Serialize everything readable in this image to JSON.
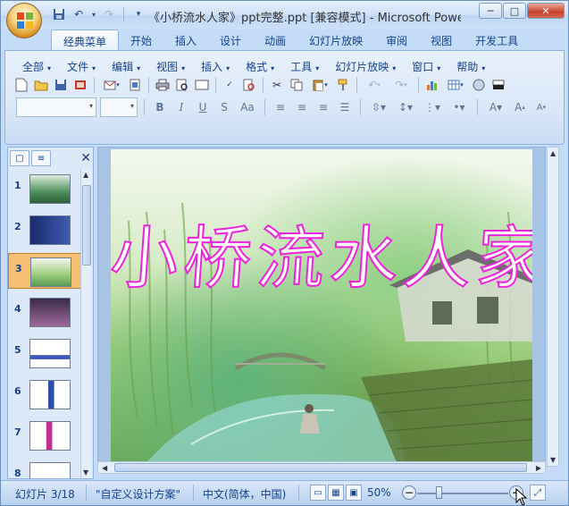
{
  "window": {
    "title": "《小桥流水人家》ppt完整.ppt [兼容模式] - Microsoft Powe...",
    "minimize": "─",
    "maximize": "□",
    "close": "✕"
  },
  "quick_access": [
    "save-icon",
    "undo-icon",
    "redo-icon",
    "customize-icon"
  ],
  "ribbon_tabs": [
    {
      "label": "经典菜单",
      "active": true
    },
    {
      "label": "开始"
    },
    {
      "label": "插入"
    },
    {
      "label": "设计"
    },
    {
      "label": "动画"
    },
    {
      "label": "幻灯片放映"
    },
    {
      "label": "审阅"
    },
    {
      "label": "视图"
    },
    {
      "label": "开发工具"
    }
  ],
  "menus": [
    "全部",
    "文件",
    "编辑",
    "视图",
    "插入",
    "格式",
    "工具",
    "幻灯片放映",
    "窗口",
    "帮助"
  ],
  "font_buttons": [
    "B",
    "I",
    "U",
    "S",
    "Aa"
  ],
  "slide_pane": {
    "tab_slides": "▢",
    "tab_outline": "≡",
    "close": "✕",
    "slides": [
      {
        "num": "1"
      },
      {
        "num": "2"
      },
      {
        "num": "3",
        "selected": true
      },
      {
        "num": "4"
      },
      {
        "num": "5"
      },
      {
        "num": "6"
      },
      {
        "num": "7"
      },
      {
        "num": "8"
      }
    ]
  },
  "slide": {
    "title": "小桥流水人家"
  },
  "status": {
    "slide_info": "幻灯片 3/18",
    "theme": "\"自定义设计方案\"",
    "language": "中文(简体，中国)",
    "zoom": "50%",
    "zoom_minus": "−",
    "zoom_plus": "+"
  },
  "colors": {
    "title_outline": "#ee22dd",
    "ribbon": "#dbe8f8",
    "selected_thumb": "#f5c073"
  }
}
